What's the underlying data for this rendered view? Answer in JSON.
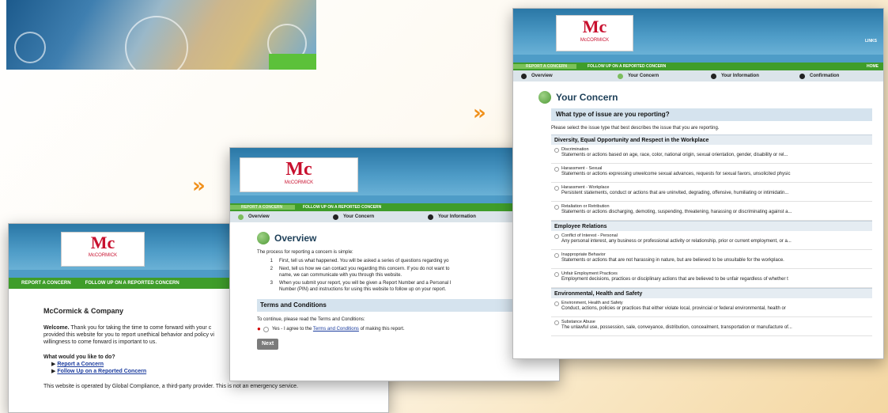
{
  "brand": {
    "logo_mark": "Mc",
    "logo_text": "McCORMICK"
  },
  "nav": {
    "report": "REPORT A CONCERN",
    "follow": "FOLLOW UP ON A REPORTED CONCERN",
    "home": "HOME",
    "links": "LINKS"
  },
  "steps": {
    "overview": "Overview",
    "concern": "Your Concern",
    "info": "Your Information",
    "confirm": "Confirmation"
  },
  "win1": {
    "title": "McCormick & Company",
    "welcome_bold": "Welcome.",
    "welcome_l1": "Thank you for taking the time to come forward with your c",
    "welcome_l2": "provided this website for you to report unethical behavior and policy vi",
    "welcome_l3": "willingness to come forward is important to us.",
    "question": "What would you like to do?",
    "opt_report": "Report a Concern",
    "opt_follow": "Follow Up on a Reported Concern",
    "footer": "This website is operated by Global Compliance, a third-party provider. This is not an emergency service."
  },
  "win2": {
    "title": "Overview",
    "intro": "The process for reporting a concern is simple:",
    "steps": [
      {
        "num": "1",
        "lines": [
          "First, tell us what happened. You will be asked a series of questions regarding yo"
        ]
      },
      {
        "num": "2",
        "lines": [
          "Next, tell us how we can contact you regarding this concern. If you do not want to",
          "name, we can communicate with you through this website."
        ]
      },
      {
        "num": "3",
        "lines": [
          "When you submit your report, you will be given a Report Number and a Personal I",
          "Number (PIN) and instructions for using this website to follow up on your report."
        ]
      }
    ],
    "terms_heading": "Terms and Conditions",
    "terms_intro": "To continue, please read the Terms and Conditions:",
    "agree_pre": "Yes - I agree to the ",
    "agree_link": "Terms and Conditions",
    "agree_post": " of making this report.",
    "next": "Next"
  },
  "win3": {
    "title": "Your Concern",
    "question": "What type of issue are you reporting?",
    "instruction": "Please select the issue type that best describes the issue that you are reporting.",
    "categories": [
      {
        "name": "Diversity, Equal Opportunity and Respect in the Workplace",
        "options": [
          {
            "title": "Discrimination",
            "desc": "Statements or actions based on age, race, color, national origin, sexual orientation, gender, disability or rel..."
          },
          {
            "title": "Harassment - Sexual",
            "desc": "Statements or actions expressing unwelcome sexual advances, requests for sexual favors, unsolicited physic"
          },
          {
            "title": "Harassment - Workplace",
            "desc": "Persistent statements, conduct or actions that are uninvited, degrading, offensive, humiliating or intimidatin..."
          },
          {
            "title": "Retaliation or Retribution",
            "desc": "Statements or actions discharging, demoting, suspending, threatening, harassing or discriminating against a..."
          }
        ]
      },
      {
        "name": "Employee Relations",
        "options": [
          {
            "title": "Conflict of Interest - Personal",
            "desc": "Any personal interest, any business or professional activity or relationship, prior or current employment, or a..."
          },
          {
            "title": "Inappropriate Behavior",
            "desc": "Statements or actions that are not harassing in nature, but are believed to be unsuitable for the workplace."
          },
          {
            "title": "Unfair Employment Practices",
            "desc": "Employment decisions, practices or disciplinary actions that are believed to be unfair regardless of whether t"
          }
        ]
      },
      {
        "name": "Environmental, Health and Safety",
        "options": [
          {
            "title": "Environment, Health and Safety",
            "desc": "Conduct, actions, policies or practices that either violate local, provincial or federal environmental, health or"
          },
          {
            "title": "Substance Abuse",
            "desc": "The unlawful use, possession, sale, conveyance, distribution, concealment, transportation or manufacture of..."
          }
        ]
      }
    ]
  },
  "decor": {
    "arrows": "»"
  }
}
